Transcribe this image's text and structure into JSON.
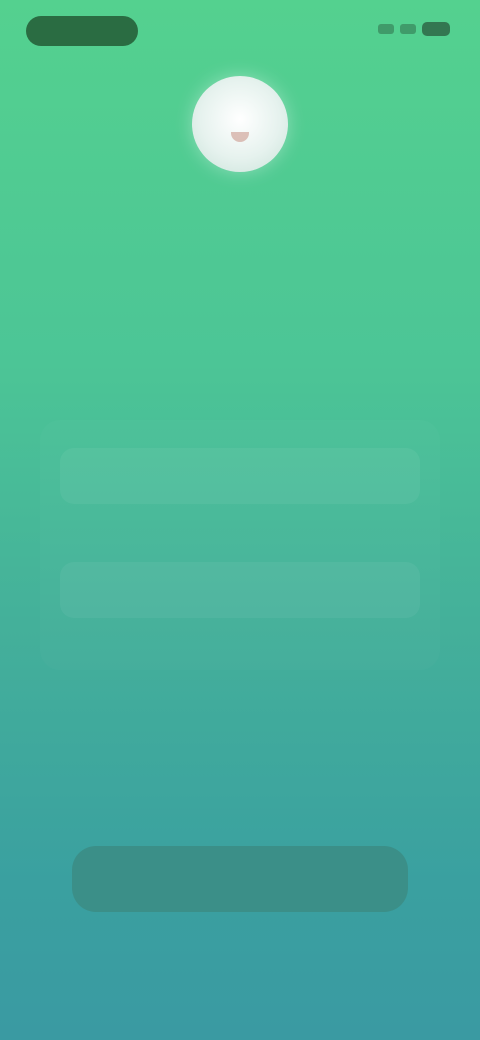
{
  "status_bar": {
    "time_pill": "",
    "icons": [
      "signal-icon",
      "wifi-icon",
      "battery-icon"
    ]
  },
  "header": {
    "avatar_icon": "avatar-icon",
    "title": ""
  },
  "form": {
    "username_placeholder": "",
    "password_placeholder": ""
  },
  "actions": {
    "login_label": "",
    "footer_link_label": ""
  },
  "colors": {
    "gradient_top": "#54d18f",
    "gradient_bottom": "#3a9aa2",
    "button_bg": "#3b8f88",
    "status_pill": "#235b35"
  }
}
